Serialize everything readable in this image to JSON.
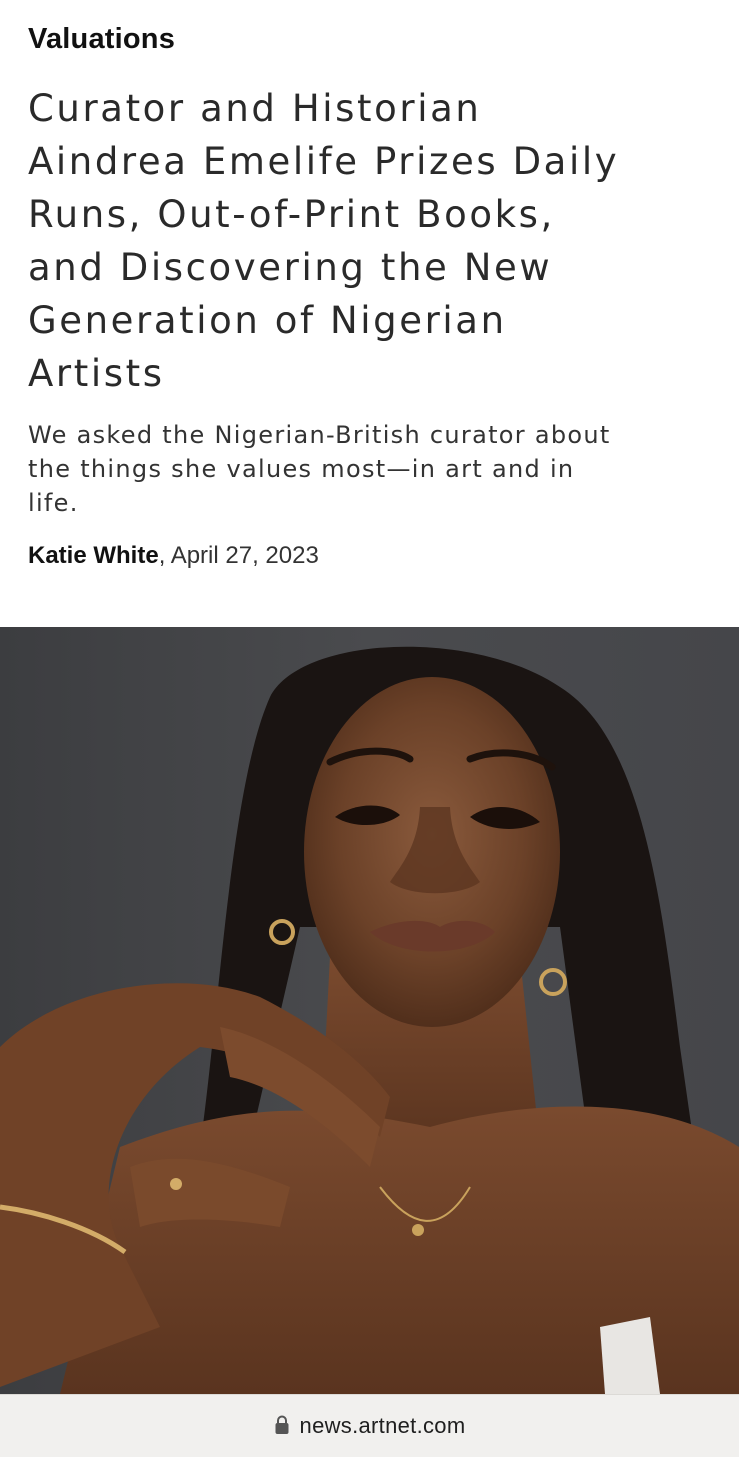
{
  "article": {
    "category": "Valuations",
    "headline": "Curator and Historian Aindrea Emelife Prizes Daily Runs, Out-of-Print Books, and Discovering the New Generation of Nigerian Artists",
    "dek": "We asked the Nigerian-British curator about the things she values most—in art and in life.",
    "author": "Katie White",
    "byline_separator": ", ",
    "date": "April 27, 2023"
  },
  "hero_image": {
    "subject": "portrait-photo",
    "background_color": "#434446"
  },
  "browser": {
    "url": "news.artnet.com",
    "icon": "lock-icon"
  }
}
